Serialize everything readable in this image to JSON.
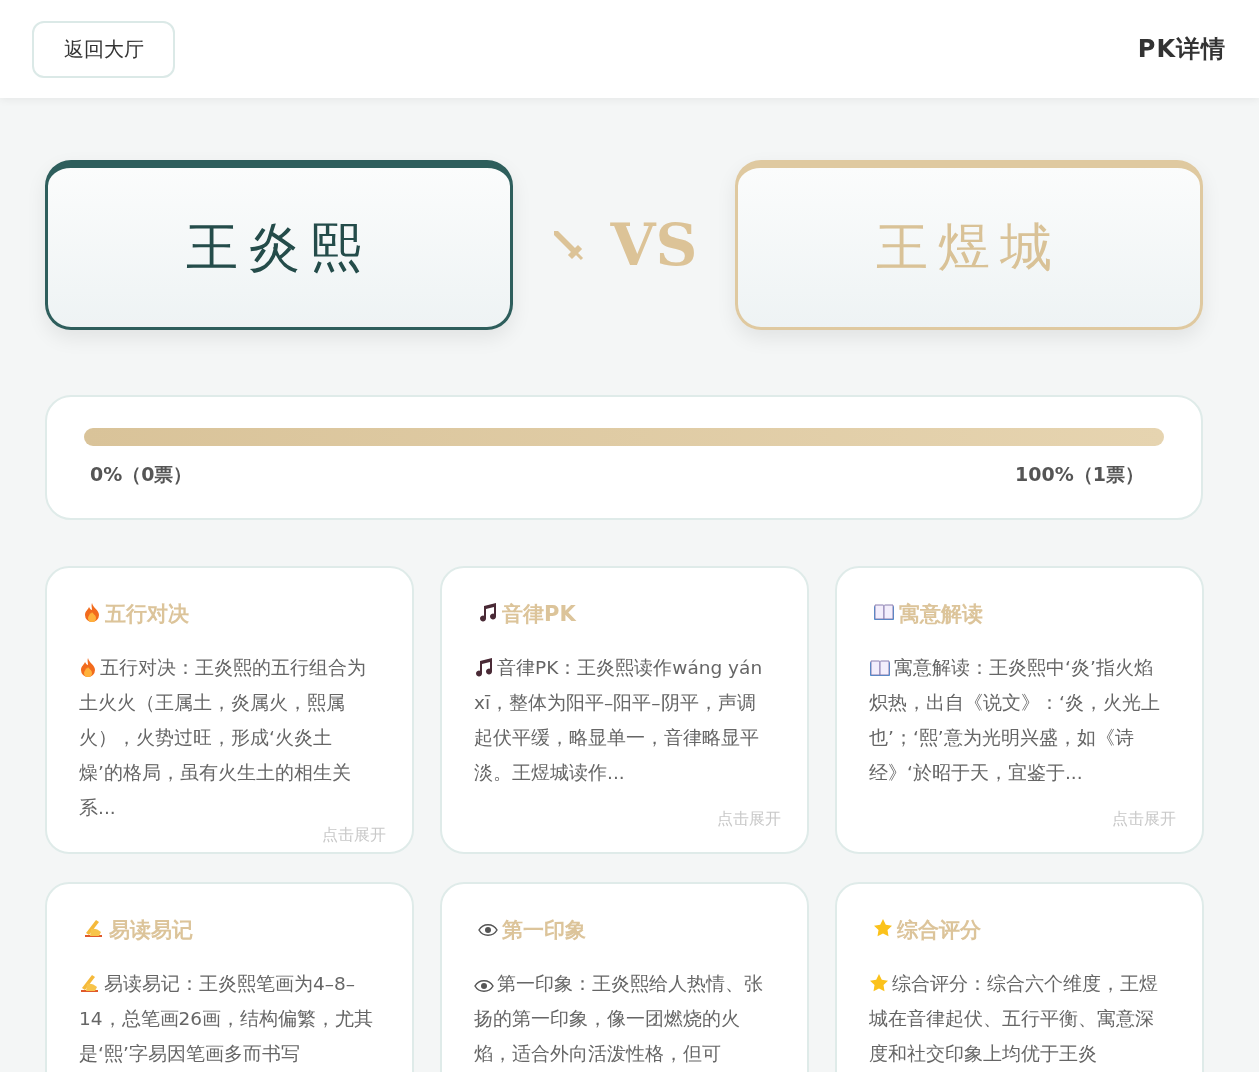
{
  "header": {
    "back_button": "返回大厅",
    "title": "PK详情"
  },
  "players": [
    {
      "name": "王炎熙",
      "kind": "teal"
    },
    {
      "name": "王煜城",
      "kind": "gold"
    }
  ],
  "versus": "VS",
  "vote_bar": {
    "level": 1,
    "left_label": "0%（0票）",
    "right_label": "100%（1票）"
  },
  "cards": [
    {
      "kind": "fire",
      "title": "五行对决",
      "body": "五行对决：王炎熙的五行组合为土火火（王属土，炎属火，熙属火），火势过旺，形成‘火炎土燥’的格局，虽有火生土的相生关系...",
      "expand": "点击展开"
    },
    {
      "kind": "music",
      "title": "音律PK",
      "body": "音律PK：王炎熙读作wáng yán xī，整体为阳平–阳平–阴平，声调起伏平缓，略显单一，音律略显平淡。王煜城读作...",
      "expand": "点击展开"
    },
    {
      "kind": "book",
      "title": "寓意解读",
      "body": "寓意解读：王炎熙中‘炎’指火焰炽热，出自《说文》：‘炎，火光上也’；‘熙’意为光明兴盛，如《诗经》‘於昭于天，宜鉴于...",
      "expand": "点击展开"
    },
    {
      "kind": "writing",
      "title": "易读易记",
      "body": "易读易记：王炎熙笔画为4–8–14，总笔画26画，结构偏繁，尤其是‘熙’字易因笔画多而书写"
    },
    {
      "kind": "eye",
      "title": "第一印象",
      "body": "第一印象：王炎熙给人热情、张扬的第一印象，像一团燃烧的火焰，适合外向活泼性格，但可"
    },
    {
      "kind": "star",
      "title": "综合评分",
      "body": "综合评分：综合六个维度，王煜城在音律起伏、五行平衡、寓意深度和社交印象上均优于王炎"
    }
  ]
}
